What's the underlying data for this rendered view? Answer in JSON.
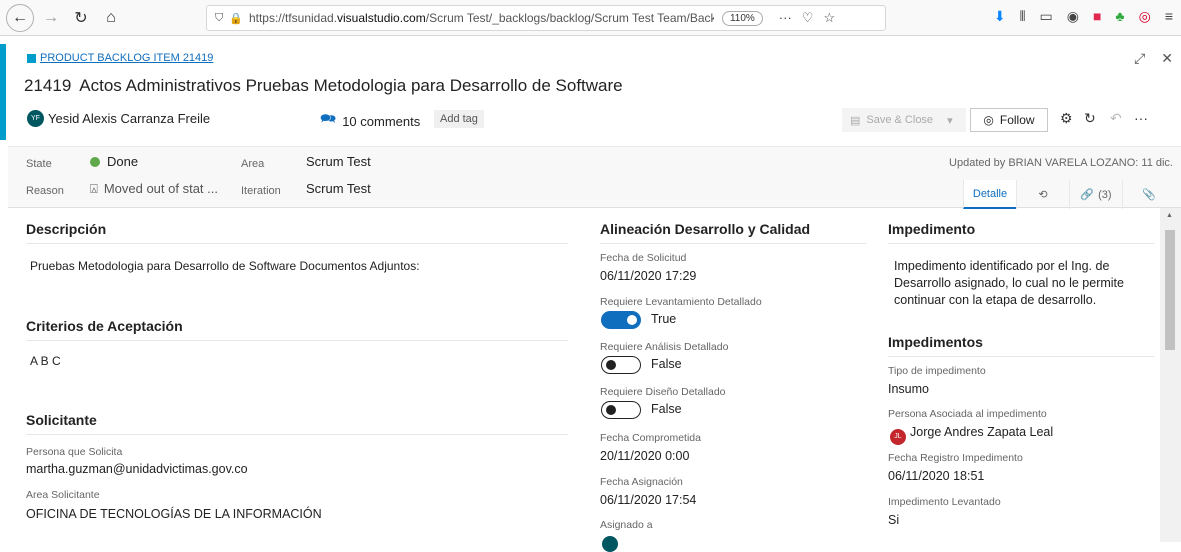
{
  "browser": {
    "url_prefix": "https://tfsunidad.",
    "url_domain": "visualstudio.com",
    "url_rest": "/Scrum Test/_backlogs/backlog/Scrum Test Team/Backlog it",
    "zoom": "110%"
  },
  "work_item": {
    "type_label": "PRODUCT BACKLOG ITEM 21419",
    "id": "21419",
    "title": "Actos Administrativos Pruebas Metodologia para Desarrollo de Software",
    "assigned_to": "Yesid Alexis Carranza Freile",
    "assigned_initials": "YF",
    "comments": "10 comments",
    "add_tag": "Add tag",
    "save_close": "Save & Close",
    "follow": "Follow"
  },
  "state_bar": {
    "state_label": "State",
    "state_value": "Done",
    "reason_label": "Reason",
    "reason_value": "Moved out of stat ...",
    "area_label": "Area",
    "area_value": "Scrum Test",
    "iteration_label": "Iteration",
    "iteration_value": "Scrum Test",
    "updated": "Updated by BRIAN VARELA LOZANO: 11 dic.",
    "tabs": {
      "detail": "Detalle",
      "links": "(3)"
    }
  },
  "left_column": {
    "description_title": "Descripción",
    "description_text": "Pruebas Metodologia para Desarrollo de Software Documentos Adjuntos:",
    "criteria_title": "Criterios de Aceptación",
    "criteria_text": "A B C",
    "requester_title": "Solicitante",
    "person_label": "Persona que Solicita",
    "person_value": "martha.guzman@unidadvictimas.gov.co",
    "area_label": "Area Solicitante",
    "area_value": "OFICINA DE TECNOLOGÍAS DE LA INFORMACIÓN"
  },
  "middle_column": {
    "title": "Alineación Desarrollo y Calidad",
    "request_date_label": "Fecha de Solicitud",
    "request_date_value": "06/11/2020 17:29",
    "req_lev_label": "Requiere Levantamiento Detallado",
    "req_lev_value": "True",
    "req_anal_label": "Requiere Análisis Detallado",
    "req_anal_value": "False",
    "req_dis_label": "Requiere Diseño Detallado",
    "req_dis_value": "False",
    "committed_label": "Fecha Comprometida",
    "committed_value": "20/11/2020 0:00",
    "assign_date_label": "Fecha Asignación",
    "assign_date_value": "06/11/2020 17:54",
    "assigned_label": "Asignado a"
  },
  "right_column": {
    "impediment_title": "Impedimento",
    "impediment_text": "Impedimento identificado por el Ing. de Desarrollo asignado, lo cual no le permite continuar con la etapa de desarrollo.",
    "impediments_title": "Impedimentos",
    "type_label": "Tipo de impedimento",
    "type_value": "Insumo",
    "person_label": "Persona Asociada al impedimento",
    "person_value": "Jorge Andres Zapata Leal",
    "person_initials": "JL",
    "date_label": "Fecha Registro Impedimento",
    "date_value": "06/11/2020 18:51",
    "lifted_label": "Impedimento Levantado",
    "lifted_value": "Si"
  }
}
